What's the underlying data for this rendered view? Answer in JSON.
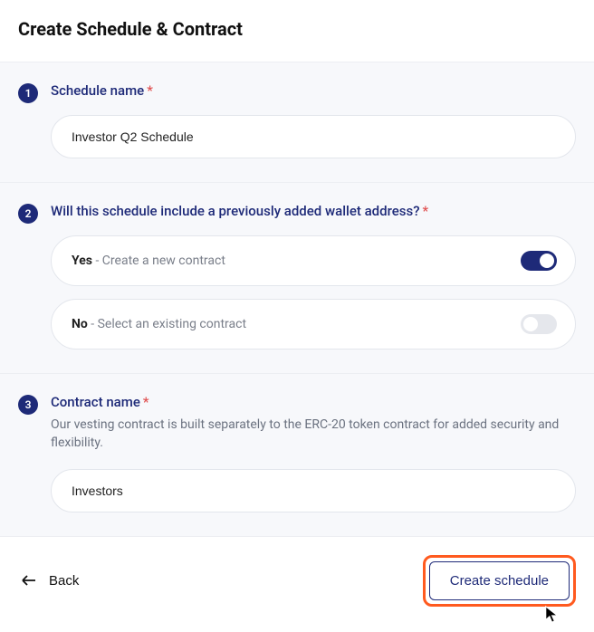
{
  "header": {
    "title": "Create Schedule & Contract"
  },
  "steps": {
    "s1": {
      "num": "1",
      "label": "Schedule name",
      "required_mark": "*",
      "value": "Investor Q2 Schedule"
    },
    "s2": {
      "num": "2",
      "label": "Will this schedule include a previously added wallet address?",
      "required_mark": "*",
      "opt_yes_bold": "Yes",
      "opt_yes_rest": " - Create a new contract",
      "opt_no_bold": "No",
      "opt_no_rest": " - Select an existing contract"
    },
    "s3": {
      "num": "3",
      "label": "Contract name",
      "required_mark": "*",
      "desc": "Our vesting contract is built separately to the ERC-20 token contract for added security and flexibility.",
      "value": "Investors"
    }
  },
  "footer": {
    "back_label": "Back",
    "primary_label": "Create schedule"
  }
}
